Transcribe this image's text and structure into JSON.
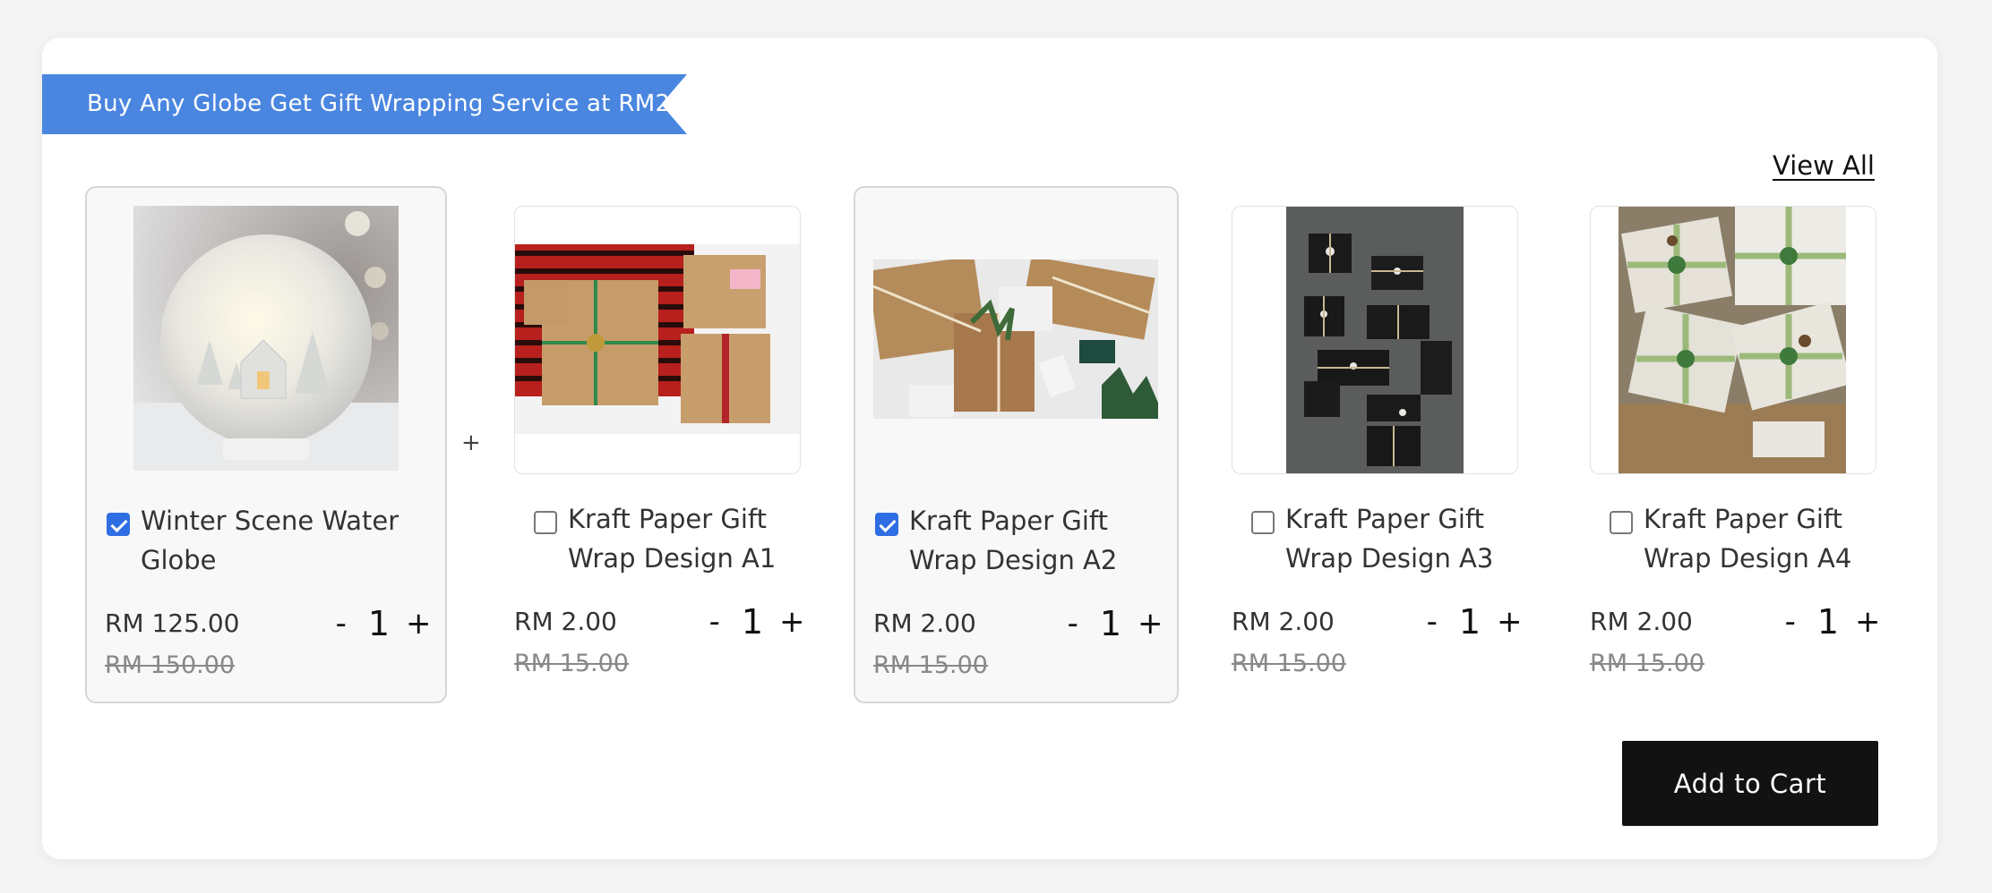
{
  "banner": {
    "text": "Buy Any Globe Get Gift Wrapping Service at RM2"
  },
  "view_all": "View All",
  "separator": "+",
  "products": [
    {
      "title": "Winter Scene Water Globe",
      "price": "RM 125.00",
      "old_price": "RM 150.00",
      "qty": "1",
      "checked": true,
      "image": "water-globe-photo"
    },
    {
      "title": "Kraft Paper Gift Wrap Design A1",
      "price": "RM 2.00",
      "old_price": "RM 15.00",
      "qty": "1",
      "checked": false,
      "image": "gift-wrap-a1-photo"
    },
    {
      "title": "Kraft Paper Gift Wrap Design A2",
      "price": "RM 2.00",
      "old_price": "RM 15.00",
      "qty": "1",
      "checked": true,
      "image": "gift-wrap-a2-photo"
    },
    {
      "title": "Kraft Paper Gift Wrap Design A3",
      "price": "RM 2.00",
      "old_price": "RM 15.00",
      "qty": "1",
      "checked": false,
      "image": "gift-wrap-a3-photo"
    },
    {
      "title": "Kraft Paper Gift Wrap Design A4",
      "price": "RM 2.00",
      "old_price": "RM 15.00",
      "qty": "1",
      "checked": false,
      "image": "gift-wrap-a4-photo"
    }
  ],
  "qty_minus": "-",
  "qty_plus": "+",
  "add_to_cart": "Add to Cart",
  "colors": {
    "accent": "#4a86e0",
    "checkbox": "#2f6de3",
    "button": "#121212"
  }
}
